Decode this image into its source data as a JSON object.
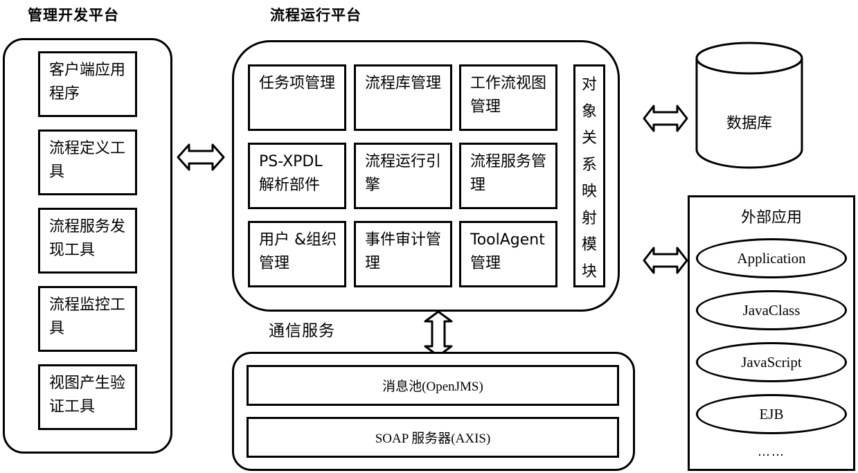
{
  "management_platform": {
    "title": "管理开发平台",
    "items": [
      {
        "label": "客户端应用程序"
      },
      {
        "label": "流程定义工具"
      },
      {
        "label": "流程服务发现工具"
      },
      {
        "label": "流程监控工具"
      },
      {
        "label": "视图产生验证工具"
      }
    ]
  },
  "runtime_platform": {
    "title": "流程运行平台",
    "modules": [
      {
        "label": "任务项管理"
      },
      {
        "label": "流程库管理"
      },
      {
        "label": "工作流视图管理"
      },
      {
        "label": "PS-XPDL解析部件"
      },
      {
        "label": "流程运行引擎"
      },
      {
        "label": "流程服务管理"
      },
      {
        "label": "用户 &组织管理"
      },
      {
        "label": "事件审计管理"
      },
      {
        "label": "ToolAgent 管理"
      }
    ],
    "orm_module": {
      "chars": [
        "对",
        "象",
        "关",
        "系",
        "映",
        "射",
        "模",
        "块"
      ]
    }
  },
  "communication_service": {
    "title": "通信服务",
    "items": [
      {
        "label": "消息池(OpenJMS)"
      },
      {
        "label": "SOAP 服务器(AXIS)"
      }
    ]
  },
  "database": {
    "label": "数据库"
  },
  "external_apps": {
    "title": "外部应用",
    "items": [
      {
        "label": "Application"
      },
      {
        "label": "JavaClass"
      },
      {
        "label": "JavaScript"
      },
      {
        "label": "EJB"
      }
    ],
    "more": "……"
  },
  "connectors": [
    {
      "from": "管理开发平台",
      "to": "流程运行平台",
      "type": "bidirectional"
    },
    {
      "from": "流程运行平台",
      "to": "数据库",
      "type": "bidirectional"
    },
    {
      "from": "流程运行平台",
      "to": "外部应用",
      "type": "bidirectional"
    },
    {
      "from": "流程运行平台",
      "to": "通信服务",
      "type": "bidirectional"
    }
  ]
}
